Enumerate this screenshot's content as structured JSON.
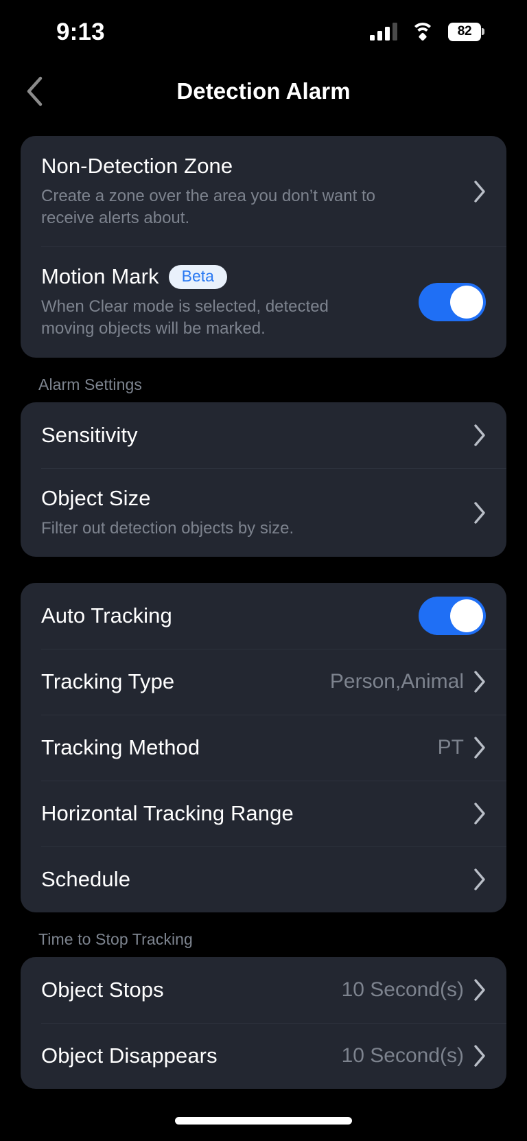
{
  "status_bar": {
    "time": "9:13",
    "signal_icon": "cellular-signal-icon",
    "wifi_icon": "wifi-icon",
    "battery_percent": "82",
    "battery_icon": "battery-icon"
  },
  "nav": {
    "back_icon": "chevron-left-icon",
    "title": "Detection Alarm"
  },
  "colors": {
    "page_background": "#000000",
    "card_background": "#232731",
    "divider": "#2d323d",
    "primary_text": "#ffffff",
    "secondary_text": "#7d838e",
    "accent_toggle_on": "#1f6ff5",
    "badge_background": "#e9f1fb",
    "badge_text": "#2a79f2",
    "chevron": "#b9bec7"
  },
  "sections": [
    {
      "id": "detection",
      "header": "",
      "rows": [
        {
          "id": "non-detection-zone",
          "title": "Non-Detection Zone",
          "subtitle": "Create a zone over the area you don’t want to receive alerts about.",
          "accessory": "chevron",
          "value": ""
        },
        {
          "id": "motion-mark",
          "title": "Motion Mark",
          "badge": "Beta",
          "subtitle": "When Clear mode is selected, detected moving objects will be marked.",
          "accessory": "toggle",
          "toggle_state": "on",
          "value": ""
        }
      ]
    },
    {
      "id": "alarm-settings",
      "header": "Alarm Settings",
      "rows": [
        {
          "id": "sensitivity",
          "title": "Sensitivity",
          "subtitle": "",
          "accessory": "chevron",
          "value": ""
        },
        {
          "id": "object-size",
          "title": "Object Size",
          "subtitle": "Filter out detection objects by size.",
          "accessory": "chevron",
          "value": ""
        }
      ]
    },
    {
      "id": "auto-tracking",
      "header": "",
      "rows": [
        {
          "id": "auto-tracking",
          "title": "Auto Tracking",
          "subtitle": "",
          "accessory": "toggle",
          "toggle_state": "on",
          "value": ""
        },
        {
          "id": "tracking-type",
          "title": "Tracking Type",
          "subtitle": "",
          "accessory": "chevron",
          "value": "Person,Animal"
        },
        {
          "id": "tracking-method",
          "title": "Tracking Method",
          "subtitle": "",
          "accessory": "chevron",
          "value": "PT"
        },
        {
          "id": "horizontal-tracking-range",
          "title": "Horizontal Tracking Range",
          "subtitle": "",
          "accessory": "chevron",
          "value": ""
        },
        {
          "id": "schedule",
          "title": "Schedule",
          "subtitle": "",
          "accessory": "chevron",
          "value": ""
        }
      ]
    },
    {
      "id": "time-to-stop-tracking",
      "header": "Time to Stop Tracking",
      "rows": [
        {
          "id": "object-stops",
          "title": "Object Stops",
          "subtitle": "",
          "accessory": "chevron",
          "value": "10 Second(s)"
        },
        {
          "id": "object-disappears",
          "title": "Object Disappears",
          "subtitle": "",
          "accessory": "chevron",
          "value": "10 Second(s)"
        }
      ]
    }
  ],
  "home_indicator": "home-indicator"
}
